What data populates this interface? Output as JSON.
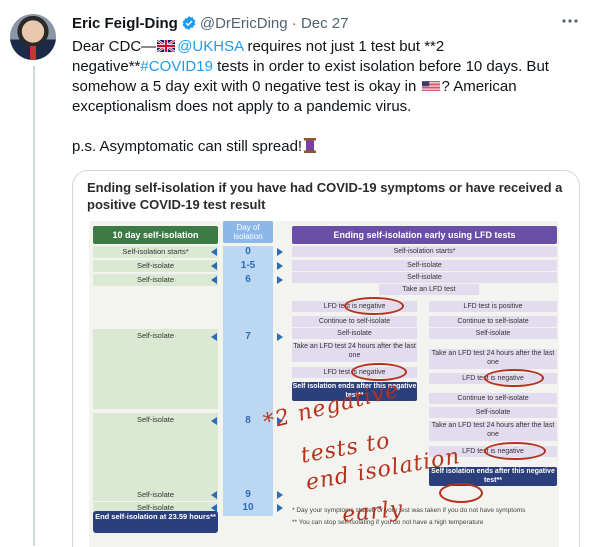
{
  "tweet": {
    "author_name": "Eric Feigl-Ding",
    "author_handle": "@DrEricDing",
    "separator": "·",
    "date": "Dec 27",
    "more_icon": "more-horizontal-icon",
    "verified_icon": "verified-badge-icon",
    "verified_color": "#1d9bf0",
    "text_part1": "Dear CDC—",
    "mention": "@UKHSA",
    "text_part2": " requires not just 1 test but **2 negative**",
    "hashtag": "#COVID19",
    "text_part3": " tests in order to exist isolation before 10 days. But somehow a 5 day exit with 0 negative test is okay in ",
    "text_part4": "? American exceptionalism does not apply to a pandemic virus.",
    "text_ps": "p.s. Asymptomatic can still spread!",
    "link_color": "#1d9bf0"
  },
  "infographic": {
    "title": "Ending self-isolation if you have had COVID-19 symptoms or have received a positive COVID-19 test result",
    "left_header": "10 day self-isolation",
    "mid_header": "Day of isolation",
    "right_header": "Ending self-isolation early using LFD tests",
    "left_rows": [
      {
        "label": "Self-isolation starts*",
        "day": "0"
      },
      {
        "label": "Self-isolate",
        "day": "1-5"
      },
      {
        "label": "Self-isolate",
        "day": "6"
      },
      {
        "label": "Self-isolate",
        "day": "7"
      },
      {
        "label": "Self-isolate",
        "day": "8"
      },
      {
        "label": "Self-isolate",
        "day": "9"
      },
      {
        "label": "Self-isolate",
        "day": "10"
      }
    ],
    "end_box": "End self-isolation at 23.59 hours**",
    "right_flow": {
      "r_start": "Self-isolation starts*",
      "r_iso1": "Self-isolate",
      "r_iso2": "Self-isolate",
      "take_lfd": "Take an LFD test",
      "lfd_negative": "LFD test is negative",
      "lfd_positive": "LFD test is positive",
      "continue1": "Continue to self-isolate",
      "continue2": "Continue to self-isolate",
      "self_isolate_a": "Self-isolate",
      "self_isolate_b": "Self-isolate",
      "take24_a": "Take an LFD test 24 hours after the last one",
      "take24_b": "Take an LFD test 24 hours after the last one",
      "lfd_negative2": "LFD test is negative",
      "lfd_negative3": "LFD test is negative",
      "ends1": "Self isolation ends after this negative test**",
      "continue3": "Continue to self-isolate",
      "self_isolate_c": "Self-isolate",
      "take24_c": "Take an LFD test 24 hours after the last one",
      "lfd_negative4": "LFD test is negative",
      "ends2": "Self isolation ends after this negative test**"
    },
    "footnote1": "* Day your symptoms started or your test was taken if you do not have symptoms",
    "footnote2": "** You can stop self-isolating if you do not have a high temperature",
    "handwriting": {
      "line1": "*2 negative",
      "line2": "tests to",
      "line3": "end isolation",
      "line4": "early",
      "ink_color": "#b5321e"
    }
  }
}
